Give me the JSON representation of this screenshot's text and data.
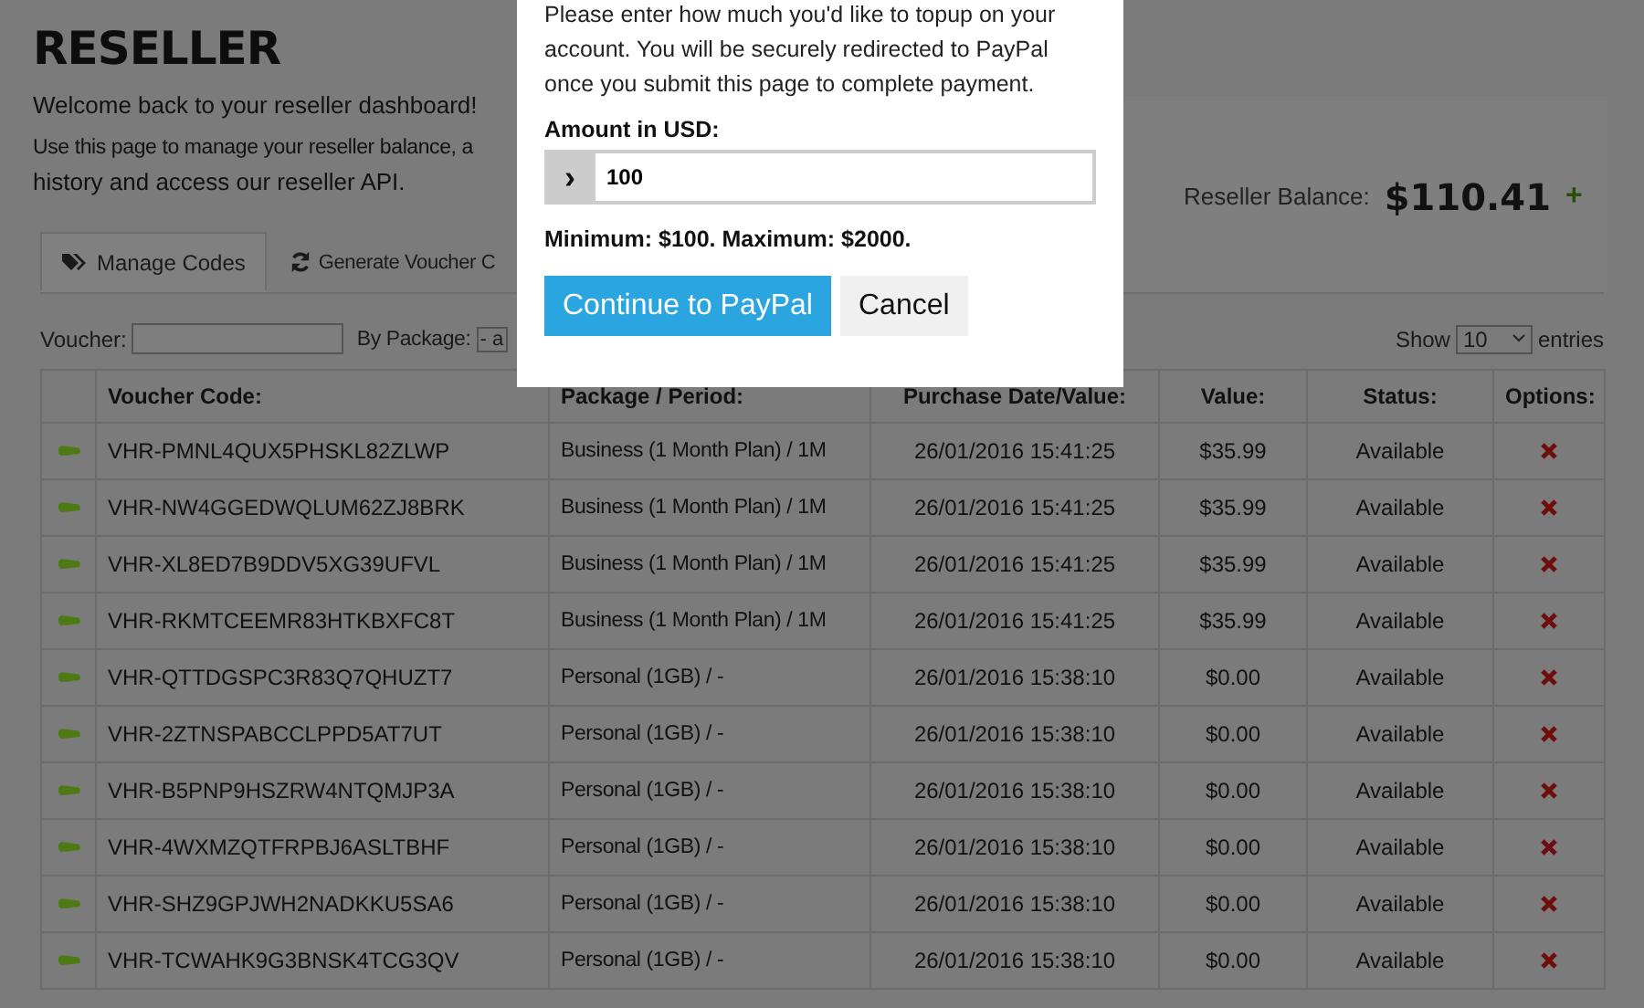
{
  "page": {
    "title": "RESELLER",
    "welcome": "Welcome back to your reseller dashboard!",
    "intro": "Use this page to manage your reseller balance, a",
    "intro_2": "history and access our reseller API."
  },
  "balance": {
    "label": "Reseller Balance:",
    "amount": "$110.41",
    "add": "+"
  },
  "tabs": [
    {
      "label": "Manage Codes",
      "selected": true
    },
    {
      "label": "Generate Voucher C",
      "selected": false
    }
  ],
  "filters": {
    "voucher_label": "Voucher:",
    "package_label": "By Package:",
    "package_value": "- a",
    "show_label": "Show",
    "show_value": "10",
    "entries_label": "entries"
  },
  "table": {
    "columns": [
      "",
      "Voucher Code:",
      "Package / Period:",
      "Purchase Date/Value:",
      "Value:",
      "Status:",
      "Options:"
    ],
    "rows": [
      {
        "code": "VHR-PMNL4QUX5PHSKL82ZLWP",
        "package": "Business (1 Month Plan) / 1M",
        "date": "26/01/2016 15:41:25",
        "value": "$35.99",
        "status": "Available"
      },
      {
        "code": "VHR-NW4GGEDWQLUM62ZJ8BRK",
        "package": "Business (1 Month Plan) / 1M",
        "date": "26/01/2016 15:41:25",
        "value": "$35.99",
        "status": "Available"
      },
      {
        "code": "VHR-XL8ED7B9DDV5XG39UFVL",
        "package": "Business (1 Month Plan) / 1M",
        "date": "26/01/2016 15:41:25",
        "value": "$35.99",
        "status": "Available"
      },
      {
        "code": "VHR-RKMTCEEMR83HTKBXFC8T",
        "package": "Business (1 Month Plan) / 1M",
        "date": "26/01/2016 15:41:25",
        "value": "$35.99",
        "status": "Available"
      },
      {
        "code": "VHR-QTTDGSPC3R83Q7QHUZT7",
        "package": "Personal (1GB) / -",
        "date": "26/01/2016 15:38:10",
        "value": "$0.00",
        "status": "Available"
      },
      {
        "code": "VHR-2ZTNSPABCCLPPD5AT7UT",
        "package": "Personal (1GB) / -",
        "date": "26/01/2016 15:38:10",
        "value": "$0.00",
        "status": "Available"
      },
      {
        "code": "VHR-B5PNP9HSZRW4NTQMJP3A",
        "package": "Personal (1GB) / -",
        "date": "26/01/2016 15:38:10",
        "value": "$0.00",
        "status": "Available"
      },
      {
        "code": "VHR-4WXMZQTFRPBJ6ASLTBHF",
        "package": "Personal (1GB) / -",
        "date": "26/01/2016 15:38:10",
        "value": "$0.00",
        "status": "Available"
      },
      {
        "code": "VHR-SHZ9GPJWH2NADKKU5SA6",
        "package": "Personal (1GB) / -",
        "date": "26/01/2016 15:38:10",
        "value": "$0.00",
        "status": "Available"
      },
      {
        "code": "VHR-TCWAHK9G3BNSK4TCG3QV",
        "package": "Personal (1GB) / -",
        "date": "26/01/2016 15:38:10",
        "value": "$0.00",
        "status": "Available"
      }
    ]
  },
  "modal": {
    "text": "Please enter how much you'd like to topup on your account. You will be securely redirected to PayPal once you submit this page to complete payment.",
    "amount_label": "Amount in USD:",
    "addon": "›",
    "amount_value": "100",
    "limits": "Minimum: $100. Maximum: $2000.",
    "buttons": [
      {
        "label": "Continue to PayPal",
        "kind": "primary"
      },
      {
        "label": "Cancel",
        "kind": "default"
      }
    ]
  }
}
